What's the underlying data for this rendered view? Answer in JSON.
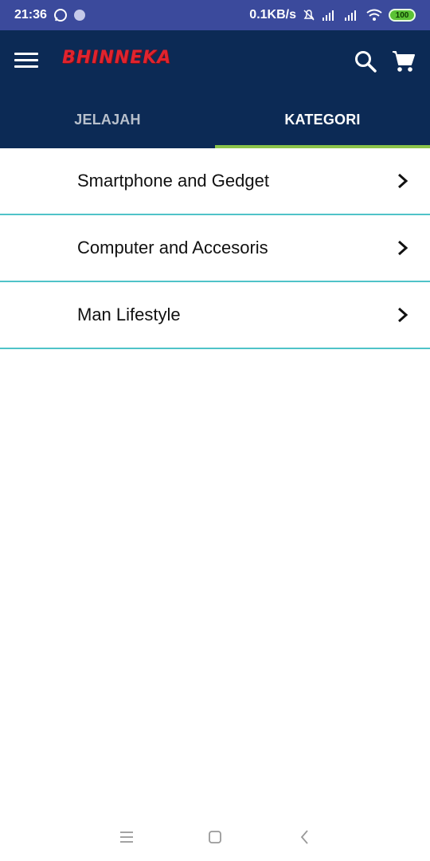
{
  "status_bar": {
    "time": "21:36",
    "speed": "0.1KB/s",
    "battery": "100"
  },
  "app": {
    "logo_text": "BHINNEKA",
    "tabs": [
      {
        "label": "JELAJAH",
        "active": false
      },
      {
        "label": "KATEGORI",
        "active": true
      }
    ]
  },
  "categories": [
    {
      "label": "Smartphone and Gedget"
    },
    {
      "label": "Computer and Accesoris"
    },
    {
      "label": "Man Lifestyle"
    }
  ],
  "colors": {
    "status_bar": "#3b4a9c",
    "app_bar": "#0c2a55",
    "tab_indicator": "#8bc34a",
    "divider": "#4fc3c8",
    "logo": "#e0232e"
  },
  "icons": {
    "menu": "hamburger-icon",
    "search": "search-icon",
    "cart": "cart-icon",
    "chevron": "chevron-right-icon"
  }
}
